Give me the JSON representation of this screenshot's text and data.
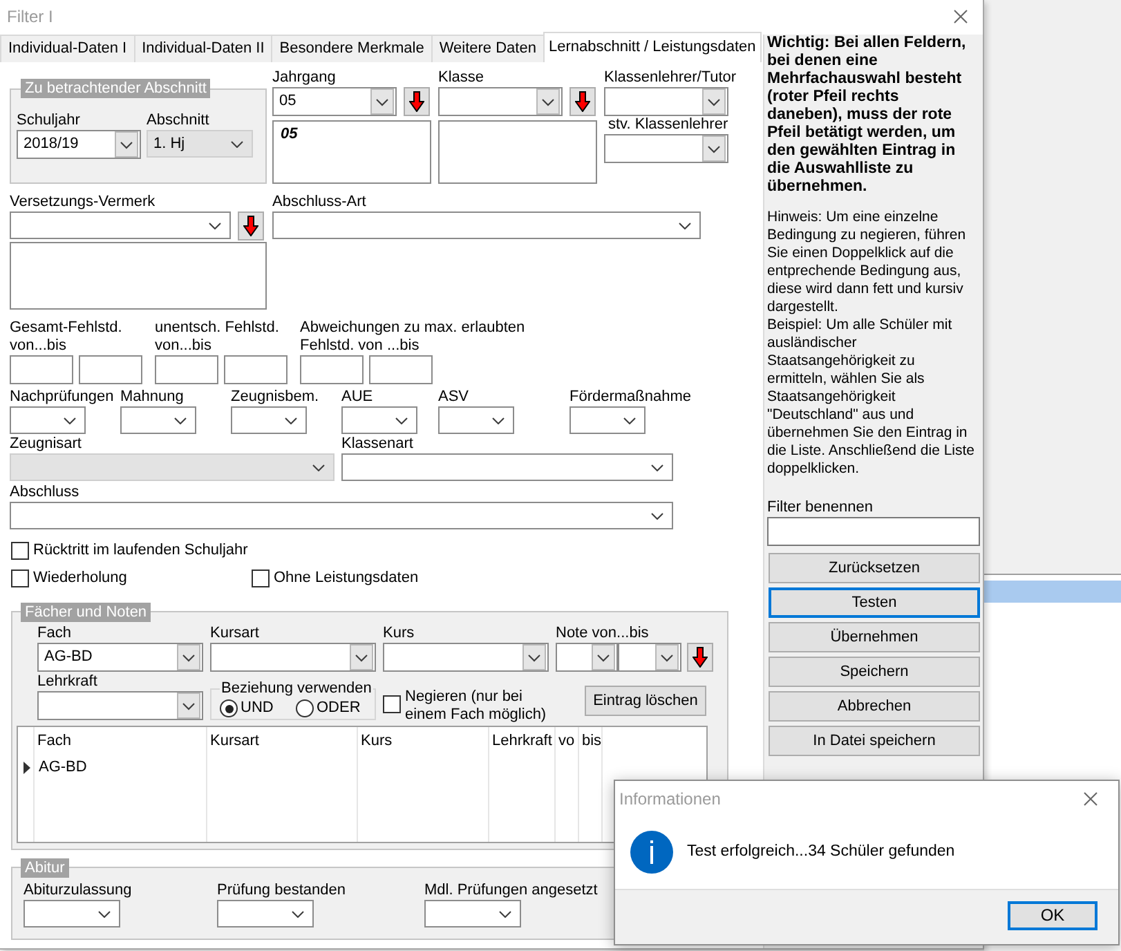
{
  "window": {
    "title": "Filter I"
  },
  "tabs": [
    {
      "label": "Individual-Daten I",
      "selected": false
    },
    {
      "label": "Individual-Daten II",
      "selected": false
    },
    {
      "label": "Besondere Merkmale",
      "selected": false
    },
    {
      "label": "Weitere Daten",
      "selected": false
    },
    {
      "label": "Lernabschnitt / Leistungsdaten",
      "selected": true
    }
  ],
  "abschnitt": {
    "title": "Zu betrachtender Abschnitt",
    "fields": [
      {
        "label": "Schuljahr",
        "value": "2018/19",
        "disabled": false
      },
      {
        "label": "Abschnitt",
        "value": "1. Hj",
        "disabled": true
      }
    ]
  },
  "multi_fields": [
    {
      "label": "Jahrgang",
      "value": "05",
      "entries": [
        {
          "text": "05",
          "negated": true
        }
      ]
    },
    {
      "label": "Klasse"
    }
  ],
  "teachers": [
    {
      "label": "Klassenlehrer/Tutor"
    },
    {
      "label": "stv. Klassenlehrer"
    }
  ],
  "versetzung": {
    "label": "Versetzungs-Vermerk"
  },
  "abschluss_art": {
    "label": "Abschluss-Art"
  },
  "absence_ranges": [
    {
      "label": "Gesamt-Fehlstd. von...bis"
    },
    {
      "label": "unentsch. Fehlstd. von...bis"
    },
    {
      "label": "Abweichungen zu max. erlaubten Fehlstd. von ...bis"
    }
  ],
  "small_selects": [
    {
      "label": "Nachprüfungen"
    },
    {
      "label": "Mahnung"
    },
    {
      "label": "Zeugnisbem."
    },
    {
      "label": "AUE"
    },
    {
      "label": "ASV"
    },
    {
      "label": "Fördermaßnahme"
    }
  ],
  "wide_selects": [
    {
      "label": "Zeugnisart",
      "disabled": true
    },
    {
      "label": "Klassenart",
      "disabled": false
    },
    {
      "label": "Abschluss",
      "disabled": false
    }
  ],
  "checkboxes": [
    {
      "label": "Rücktritt im laufenden Schuljahr",
      "checked": false
    },
    {
      "label": "Wiederholung",
      "checked": false
    },
    {
      "label": "Ohne Leistungsdaten",
      "checked": false
    }
  ],
  "subjects": {
    "title": "Fächer und Noten",
    "fields": [
      {
        "label": "Fach",
        "value": "AG-BD"
      },
      {
        "label": "Kursart"
      },
      {
        "label": "Kurs"
      },
      {
        "label": "Note von...bis"
      },
      {
        "label": "Lehrkraft"
      }
    ],
    "relation": {
      "title": "Beziehung verwenden",
      "options": [
        {
          "label": "UND",
          "selected": true
        },
        {
          "label": "ODER",
          "selected": false
        }
      ]
    },
    "negate": {
      "label": "Negieren (nur bei einem Fach möglich)",
      "checked": false
    },
    "delete_button": {
      "label": "Eintrag löschen"
    },
    "table": {
      "columns": [
        "Fach",
        "Kursart",
        "Kurs",
        "Lehrkraft",
        "vo",
        "bis"
      ],
      "rows": [
        {
          "cells": [
            "AG-BD"
          ],
          "current": true
        }
      ]
    }
  },
  "abitur": {
    "title": "Abitur",
    "fields": [
      {
        "label": "Abiturzulassung"
      },
      {
        "label": "Prüfung bestanden"
      },
      {
        "label": "Mdl. Prüfungen angesetzt"
      }
    ]
  },
  "side_panel": {
    "notice": "Wichtig: Bei allen Feldern, bei denen eine Mehrfachauswahl besteht (roter Pfeil rechts daneben), muss der rote Pfeil betätigt werden, um den gewählten Eintrag in die Auswahlliste zu übernehmen.",
    "hint": "Hinweis: Um eine einzelne Bedingung zu negieren, führen Sie einen Doppelklick auf die entprechende Bedingung aus, diese wird dann fett und kursiv dargestellt.",
    "example": "Beispiel: Um alle Schüler mit ausländischer Staatsangehörigkeit zu ermitteln, wählen Sie als Staatsangehörigkeit \"Deutschland\" aus und übernehmen Sie den Eintrag in die Liste. Anschließend die Liste doppelklicken.",
    "filter_name": {
      "label": "Filter benennen"
    },
    "buttons": [
      {
        "label": "Zurücksetzen",
        "focused": false
      },
      {
        "label": "Testen",
        "focused": true
      },
      {
        "label": "Übernehmen",
        "focused": false
      },
      {
        "label": "Speichern",
        "focused": false
      },
      {
        "label": "Abbrechen",
        "focused": false
      },
      {
        "label": "In Datei speichern",
        "focused": false
      }
    ]
  },
  "dialog": {
    "title": "Informationen",
    "message": "Test erfolgreich...34 Schüler gefunden",
    "button": {
      "label": "OK",
      "focused": true
    }
  },
  "background_list": {
    "rows": [
      {
        "selected": true
      }
    ]
  }
}
